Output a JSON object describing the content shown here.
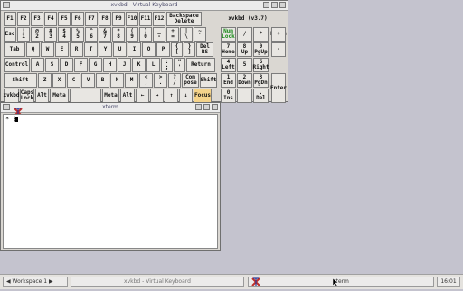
{
  "desktop_bg": "#c4c3ce",
  "keyboard_window": {
    "title": "xvkbd - Virtual Keyboard",
    "app_label": "xvkbd (v3.7)",
    "rows": [
      [
        "F1",
        "F2",
        "F3",
        "F4",
        "F5",
        "F6",
        "F7",
        "F8",
        "F9",
        "F10",
        "F11",
        "F12",
        "Backspace\nDelete"
      ],
      [
        "Esc",
        "!\n1",
        "@\n2",
        "#\n3",
        "$\n4",
        "%\n5",
        "^\n6",
        "&\n7",
        "*\n8",
        "(\n9",
        ")\n0",
        "_\n-",
        "+\n=",
        "|\n\\",
        "~\n`"
      ],
      [
        "Tab",
        "Q",
        "W",
        "E",
        "R",
        "T",
        "Y",
        "U",
        "I",
        "O",
        "P",
        "{\n[",
        "}\n]",
        "Del\nBS"
      ],
      [
        "Control",
        "A",
        "S",
        "D",
        "F",
        "G",
        "H",
        "J",
        "K",
        "L",
        ":\n;",
        "\"\n'",
        "Return"
      ],
      [
        "Shift",
        "Z",
        "X",
        "C",
        "V",
        "B",
        "N",
        "M",
        "<\n,",
        ">\n.",
        "?\n/",
        "Com\npose",
        "Shift"
      ],
      [
        "xvkbd",
        "Caps\nLock",
        "Alt",
        "Meta",
        "",
        "Meta",
        "Alt",
        "←",
        "→",
        "↑",
        "↓",
        "Focus"
      ]
    ],
    "top_focus": "Focus",
    "keypad": [
      [
        "Num\nLock",
        "/",
        "*",
        "+"
      ],
      [
        "7\nHome",
        "8\nUp",
        "9\nPgUp",
        "-"
      ],
      [
        "4\nLeft",
        "5\n",
        "6\nRight",
        ""
      ],
      [
        "1\nEnd",
        "2\nDown",
        "3\nPgDn",
        "Enter"
      ],
      [
        "0\nIns",
        "",
        "․\nDel",
        ""
      ]
    ]
  },
  "xterm_window": {
    "title": "xterm",
    "prompt": "* $"
  },
  "panel": {
    "workspace": "◀ Workspace 1 ▶",
    "task1": "xvkbd - Virtual Keyboard",
    "task2": "xterm",
    "clock": "16:01"
  }
}
